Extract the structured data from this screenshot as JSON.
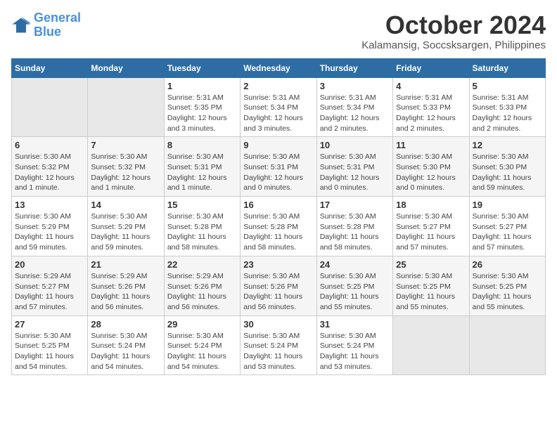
{
  "logo": {
    "line1": "General",
    "line2": "Blue"
  },
  "title": "October 2024",
  "subtitle": "Kalamansig, Soccsksargen, Philippines",
  "days_of_week": [
    "Sunday",
    "Monday",
    "Tuesday",
    "Wednesday",
    "Thursday",
    "Friday",
    "Saturday"
  ],
  "weeks": [
    [
      {
        "day": "",
        "info": ""
      },
      {
        "day": "",
        "info": ""
      },
      {
        "day": "1",
        "info": "Sunrise: 5:31 AM\nSunset: 5:35 PM\nDaylight: 12 hours and 3 minutes."
      },
      {
        "day": "2",
        "info": "Sunrise: 5:31 AM\nSunset: 5:34 PM\nDaylight: 12 hours and 3 minutes."
      },
      {
        "day": "3",
        "info": "Sunrise: 5:31 AM\nSunset: 5:34 PM\nDaylight: 12 hours and 2 minutes."
      },
      {
        "day": "4",
        "info": "Sunrise: 5:31 AM\nSunset: 5:33 PM\nDaylight: 12 hours and 2 minutes."
      },
      {
        "day": "5",
        "info": "Sunrise: 5:31 AM\nSunset: 5:33 PM\nDaylight: 12 hours and 2 minutes."
      }
    ],
    [
      {
        "day": "6",
        "info": "Sunrise: 5:30 AM\nSunset: 5:32 PM\nDaylight: 12 hours and 1 minute."
      },
      {
        "day": "7",
        "info": "Sunrise: 5:30 AM\nSunset: 5:32 PM\nDaylight: 12 hours and 1 minute."
      },
      {
        "day": "8",
        "info": "Sunrise: 5:30 AM\nSunset: 5:31 PM\nDaylight: 12 hours and 1 minute."
      },
      {
        "day": "9",
        "info": "Sunrise: 5:30 AM\nSunset: 5:31 PM\nDaylight: 12 hours and 0 minutes."
      },
      {
        "day": "10",
        "info": "Sunrise: 5:30 AM\nSunset: 5:31 PM\nDaylight: 12 hours and 0 minutes."
      },
      {
        "day": "11",
        "info": "Sunrise: 5:30 AM\nSunset: 5:30 PM\nDaylight: 12 hours and 0 minutes."
      },
      {
        "day": "12",
        "info": "Sunrise: 5:30 AM\nSunset: 5:30 PM\nDaylight: 11 hours and 59 minutes."
      }
    ],
    [
      {
        "day": "13",
        "info": "Sunrise: 5:30 AM\nSunset: 5:29 PM\nDaylight: 11 hours and 59 minutes."
      },
      {
        "day": "14",
        "info": "Sunrise: 5:30 AM\nSunset: 5:29 PM\nDaylight: 11 hours and 59 minutes."
      },
      {
        "day": "15",
        "info": "Sunrise: 5:30 AM\nSunset: 5:28 PM\nDaylight: 11 hours and 58 minutes."
      },
      {
        "day": "16",
        "info": "Sunrise: 5:30 AM\nSunset: 5:28 PM\nDaylight: 11 hours and 58 minutes."
      },
      {
        "day": "17",
        "info": "Sunrise: 5:30 AM\nSunset: 5:28 PM\nDaylight: 11 hours and 58 minutes."
      },
      {
        "day": "18",
        "info": "Sunrise: 5:30 AM\nSunset: 5:27 PM\nDaylight: 11 hours and 57 minutes."
      },
      {
        "day": "19",
        "info": "Sunrise: 5:30 AM\nSunset: 5:27 PM\nDaylight: 11 hours and 57 minutes."
      }
    ],
    [
      {
        "day": "20",
        "info": "Sunrise: 5:29 AM\nSunset: 5:27 PM\nDaylight: 11 hours and 57 minutes."
      },
      {
        "day": "21",
        "info": "Sunrise: 5:29 AM\nSunset: 5:26 PM\nDaylight: 11 hours and 56 minutes."
      },
      {
        "day": "22",
        "info": "Sunrise: 5:29 AM\nSunset: 5:26 PM\nDaylight: 11 hours and 56 minutes."
      },
      {
        "day": "23",
        "info": "Sunrise: 5:30 AM\nSunset: 5:26 PM\nDaylight: 11 hours and 56 minutes."
      },
      {
        "day": "24",
        "info": "Sunrise: 5:30 AM\nSunset: 5:25 PM\nDaylight: 11 hours and 55 minutes."
      },
      {
        "day": "25",
        "info": "Sunrise: 5:30 AM\nSunset: 5:25 PM\nDaylight: 11 hours and 55 minutes."
      },
      {
        "day": "26",
        "info": "Sunrise: 5:30 AM\nSunset: 5:25 PM\nDaylight: 11 hours and 55 minutes."
      }
    ],
    [
      {
        "day": "27",
        "info": "Sunrise: 5:30 AM\nSunset: 5:25 PM\nDaylight: 11 hours and 54 minutes."
      },
      {
        "day": "28",
        "info": "Sunrise: 5:30 AM\nSunset: 5:24 PM\nDaylight: 11 hours and 54 minutes."
      },
      {
        "day": "29",
        "info": "Sunrise: 5:30 AM\nSunset: 5:24 PM\nDaylight: 11 hours and 54 minutes."
      },
      {
        "day": "30",
        "info": "Sunrise: 5:30 AM\nSunset: 5:24 PM\nDaylight: 11 hours and 53 minutes."
      },
      {
        "day": "31",
        "info": "Sunrise: 5:30 AM\nSunset: 5:24 PM\nDaylight: 11 hours and 53 minutes."
      },
      {
        "day": "",
        "info": ""
      },
      {
        "day": "",
        "info": ""
      }
    ]
  ]
}
